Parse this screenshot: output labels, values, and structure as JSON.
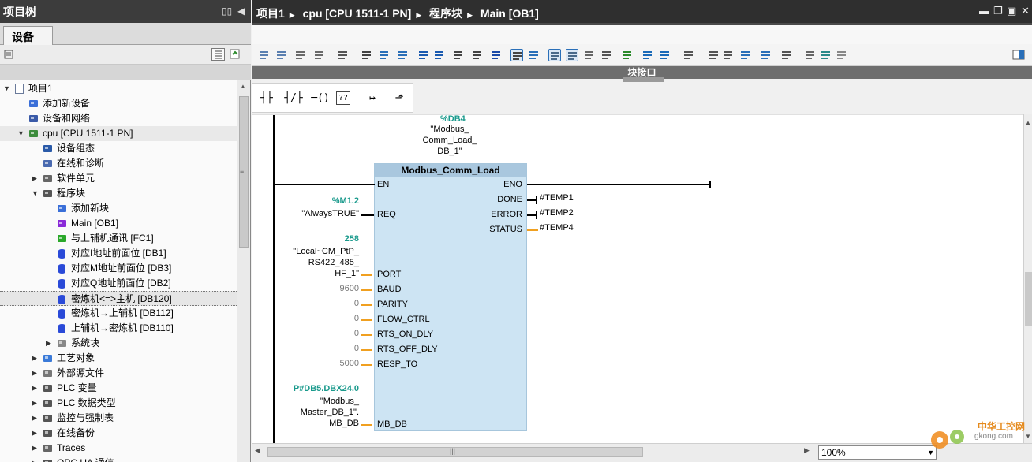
{
  "left_panel": {
    "title": "项目树",
    "tab": "设备",
    "tree": [
      {
        "label": "项目1",
        "level": 0,
        "expander": "open",
        "icon": "project-icon"
      },
      {
        "label": "添加新设备",
        "level": 1,
        "expander": "none",
        "icon": "add-device-icon"
      },
      {
        "label": "设备和网络",
        "level": 1,
        "expander": "none",
        "icon": "network-icon"
      },
      {
        "label": "cpu [CPU 1511-1 PN]",
        "level": 1,
        "expander": "open",
        "icon": "cpu-icon"
      },
      {
        "label": "设备组态",
        "level": 2,
        "expander": "none",
        "icon": "device-config-icon"
      },
      {
        "label": "在线和诊断",
        "level": 2,
        "expander": "none",
        "icon": "diagnostics-icon"
      },
      {
        "label": "软件单元",
        "level": 2,
        "expander": "closed",
        "icon": "software-unit-icon"
      },
      {
        "label": "程序块",
        "level": 2,
        "expander": "open",
        "icon": "program-blocks-icon"
      },
      {
        "label": "添加新块",
        "level": 3,
        "expander": "none",
        "icon": "add-block-icon"
      },
      {
        "label": "Main [OB1]",
        "level": 3,
        "expander": "none",
        "icon": "ob-icon"
      },
      {
        "label": "与上辅机通讯 [FC1]",
        "level": 3,
        "expander": "none",
        "icon": "fc-icon"
      },
      {
        "label": "对应I地址前面位 [DB1]",
        "level": 3,
        "expander": "none",
        "icon": "db-icon"
      },
      {
        "label": "对应M地址前面位 [DB3]",
        "level": 3,
        "expander": "none",
        "icon": "db-icon"
      },
      {
        "label": "对应Q地址前面位 [DB2]",
        "level": 3,
        "expander": "none",
        "icon": "db-icon"
      },
      {
        "label": "密炼机<=>主机 [DB120]",
        "level": 3,
        "expander": "none",
        "icon": "db-icon"
      },
      {
        "label": "密炼机→上辅机 [DB112]",
        "level": 3,
        "expander": "none",
        "icon": "db-icon"
      },
      {
        "label": "上辅机→密炼机 [DB110]",
        "level": 3,
        "expander": "none",
        "icon": "db-icon"
      },
      {
        "label": "系统块",
        "level": 3,
        "expander": "closed",
        "icon": "system-block-icon"
      },
      {
        "label": "工艺对象",
        "level": 2,
        "expander": "closed",
        "icon": "tech-object-icon"
      },
      {
        "label": "外部源文件",
        "level": 2,
        "expander": "closed",
        "icon": "external-source-icon"
      },
      {
        "label": "PLC 变量",
        "level": 2,
        "expander": "closed",
        "icon": "plc-tags-icon"
      },
      {
        "label": "PLC 数据类型",
        "level": 2,
        "expander": "closed",
        "icon": "plc-datatype-icon"
      },
      {
        "label": "监控与强制表",
        "level": 2,
        "expander": "closed",
        "icon": "watch-table-icon"
      },
      {
        "label": "在线备份",
        "level": 2,
        "expander": "closed",
        "icon": "online-backup-icon"
      },
      {
        "label": "Traces",
        "level": 2,
        "expander": "closed",
        "icon": "traces-icon"
      },
      {
        "label": "OPC UA 通信",
        "level": 2,
        "expander": "closed",
        "icon": "opcua-icon"
      }
    ]
  },
  "editor": {
    "breadcrumb": [
      "项目1",
      "cpu [CPU 1511-1 PN]",
      "程序块",
      "Main [OB1]"
    ],
    "interface_label": "块接口",
    "zoom": "100%",
    "instance": {
      "addr": "%DB4",
      "name_lines": [
        "\"Modbus_",
        "Comm_Load_",
        "DB_1\""
      ]
    },
    "block_name": "Modbus_Comm_Load",
    "inputs": [
      {
        "pin": "EN",
        "addr": "",
        "value_lines": [],
        "kind": "black"
      },
      {
        "pin": "REQ",
        "addr": "%M1.2",
        "value_lines": [
          "\"AlwaysTRUE\""
        ],
        "kind": "black"
      },
      {
        "pin": "PORT",
        "addr": "258",
        "value_lines": [
          "\"Local~CM_PtP_",
          "RS422_485_",
          "HF_1\""
        ],
        "kind": "orange"
      },
      {
        "pin": "BAUD",
        "addr": "",
        "value_lines": [
          "9600"
        ],
        "kind": "orange"
      },
      {
        "pin": "PARITY",
        "addr": "",
        "value_lines": [
          "0"
        ],
        "kind": "orange"
      },
      {
        "pin": "FLOW_CTRL",
        "addr": "",
        "value_lines": [
          "0"
        ],
        "kind": "orange"
      },
      {
        "pin": "RTS_ON_DLY",
        "addr": "",
        "value_lines": [
          "0"
        ],
        "kind": "orange"
      },
      {
        "pin": "RTS_OFF_DLY",
        "addr": "",
        "value_lines": [
          "0"
        ],
        "kind": "orange"
      },
      {
        "pin": "RESP_TO",
        "addr": "",
        "value_lines": [
          "5000"
        ],
        "kind": "orange"
      },
      {
        "pin": "MB_DB",
        "addr": "P#DB5.DBX24.0",
        "value_lines": [
          "\"Modbus_",
          "Master_DB_1\".",
          "MB_DB"
        ],
        "kind": "orange"
      }
    ],
    "outputs": [
      {
        "pin": "ENO",
        "value": ""
      },
      {
        "pin": "DONE",
        "value": "#TEMP1"
      },
      {
        "pin": "ERROR",
        "value": "#TEMP2"
      },
      {
        "pin": "STATUS",
        "value": "#TEMP4"
      }
    ]
  },
  "watermark": {
    "line1": "中华工控网",
    "line2": "gkong.com"
  },
  "colors": {
    "accent_teal": "#1a9a8c",
    "fb_body": "#cde4f3",
    "orange_wire": "#f0a020",
    "title_bar": "#2f2f2f"
  }
}
